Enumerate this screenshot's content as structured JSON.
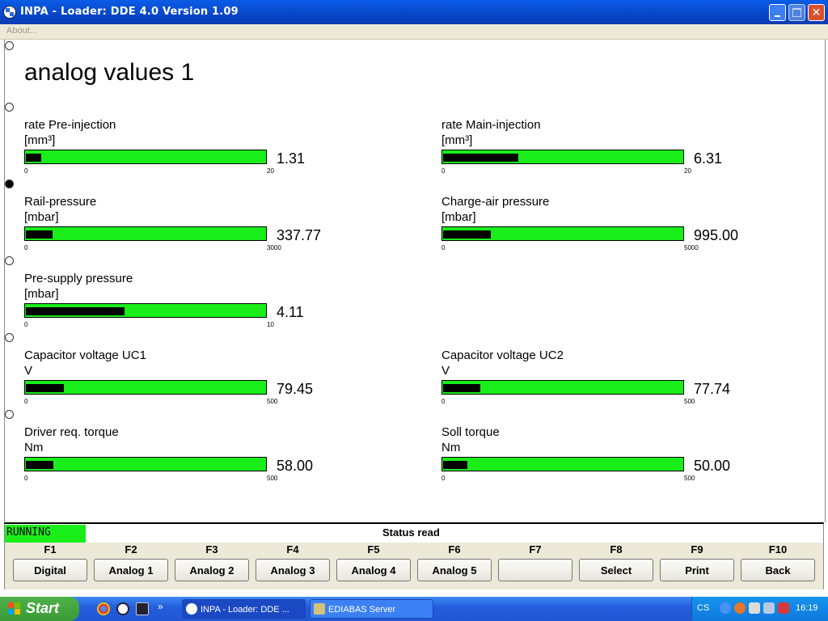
{
  "window": {
    "title": "INPA - Loader:  DDE 4.0 Version 1.09",
    "controls": {
      "minimize": "minimize",
      "maximize": "maximize",
      "close": "close"
    }
  },
  "menu": {
    "about": "About..."
  },
  "page": {
    "title": "analog values 1"
  },
  "gauges": [
    {
      "label": "rate Pre-injection",
      "unit": "[mm³]",
      "value": "1.31",
      "min": "0",
      "max": "20",
      "fraction": 0.0655
    },
    {
      "label": "rate Main-injection",
      "unit": "[mm³]",
      "value": "6.31",
      "min": "0",
      "max": "20",
      "fraction": 0.3155
    },
    {
      "label": "Rail-pressure",
      "unit": "[mbar]",
      "value": "337.77",
      "min": "0",
      "max": "3000",
      "fraction": 0.1126
    },
    {
      "label": "Charge-air pressure",
      "unit": "[mbar]",
      "value": "995.00",
      "min": "0",
      "max": "5000",
      "fraction": 0.199
    },
    {
      "label": "Pre-supply pressure",
      "unit": "[mbar]",
      "value": "4.11",
      "min": "0",
      "max": "10",
      "fraction": 0.411
    },
    {
      "label": "Capacitor voltage UC1",
      "unit": "V",
      "value": "79.45",
      "min": "0",
      "max": "500",
      "fraction": 0.1589
    },
    {
      "label": "Capacitor voltage UC2",
      "unit": "V",
      "value": "77.74",
      "min": "0",
      "max": "500",
      "fraction": 0.1555
    },
    {
      "label": "Driver req. torque",
      "unit": "Nm",
      "value": "58.00",
      "min": "0",
      "max": "500",
      "fraction": 0.116
    },
    {
      "label": "Soll torque",
      "unit": "Nm",
      "value": "50.00",
      "min": "0",
      "max": "500",
      "fraction": 0.1
    }
  ],
  "status": {
    "state": "RUNNING",
    "text": "Status read"
  },
  "fkeys": [
    {
      "key": "F1",
      "label": "Digital"
    },
    {
      "key": "F2",
      "label": "Analog 1"
    },
    {
      "key": "F3",
      "label": "Analog 2"
    },
    {
      "key": "F4",
      "label": "Analog 3"
    },
    {
      "key": "F5",
      "label": "Analog 4"
    },
    {
      "key": "F6",
      "label": "Analog 5"
    },
    {
      "key": "F7",
      "label": ""
    },
    {
      "key": "F8",
      "label": "Select"
    },
    {
      "key": "F9",
      "label": "Print"
    },
    {
      "key": "F10",
      "label": "Back"
    }
  ],
  "taskbar": {
    "start": "Start",
    "tasks": [
      "INPA - Loader:  DDE ...",
      "EDIABAS Server"
    ],
    "tray": {
      "lang": "CS",
      "time": "16:19"
    }
  },
  "colors": {
    "bar_green": "#1aee1a",
    "bar_fill": "#000000",
    "titlebar": "#0a5ce6"
  },
  "icons": {
    "app": "bmw-logo-icon",
    "quicklaunch": [
      "chrome-icon",
      "bmw-logo-icon",
      "terminal-icon"
    ],
    "tray": [
      "back-arrow-icon",
      "firefox-icon",
      "network-icon",
      "speaker-icon",
      "security-shield-icon"
    ]
  }
}
